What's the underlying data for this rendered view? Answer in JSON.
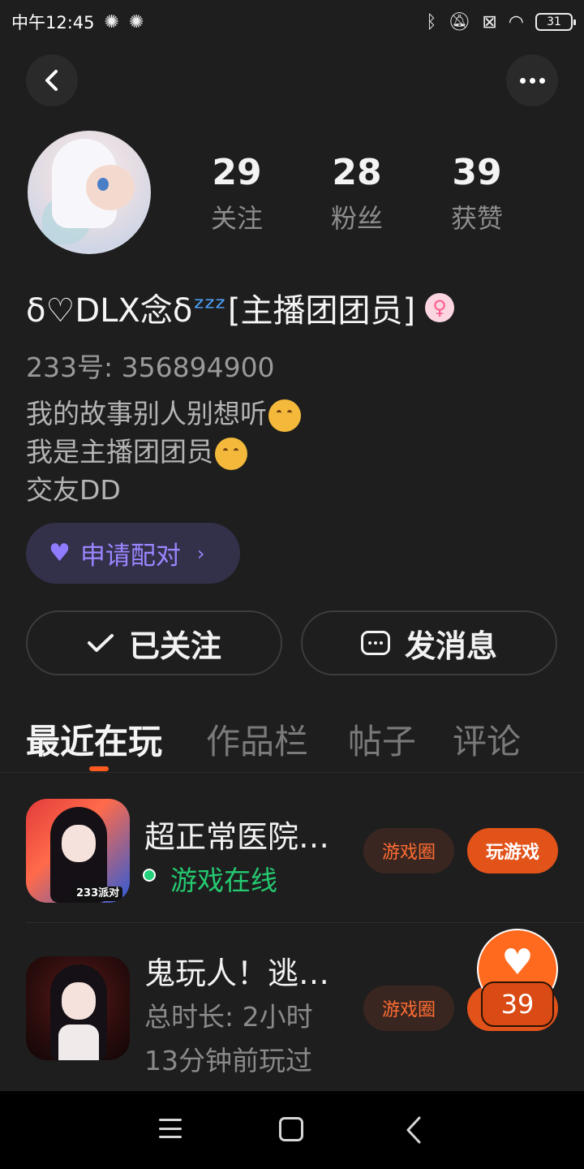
{
  "status_bar": {
    "time": "中午12:45",
    "battery": "31"
  },
  "profile": {
    "nickname_part1": "δ♡DLX念δ",
    "nickname_part2": "[主播团团员]",
    "gender_symbol": "♀",
    "id_text": "233号: 356894900",
    "bio_line1": "我的故事别人别想听",
    "bio_line2": "我是主播团团员",
    "bio_line3": "交友DD"
  },
  "stats": [
    {
      "value": "29",
      "label": "关注"
    },
    {
      "value": "28",
      "label": "粉丝"
    },
    {
      "value": "39",
      "label": "获赞"
    }
  ],
  "pair_button": {
    "label": "申请配对"
  },
  "follow_button": {
    "label": "已关注"
  },
  "message_button": {
    "label": "发消息"
  },
  "tabs": [
    {
      "label": "最近在玩",
      "active": true
    },
    {
      "label": "作品栏",
      "active": false
    },
    {
      "label": "帖子",
      "active": false
    },
    {
      "label": "评论",
      "active": false
    }
  ],
  "games": [
    {
      "title": "超正常医院…",
      "status": "游戏在线",
      "icon_tag": "233派对",
      "circle_label": "游戏圈",
      "play_label": "玩游戏"
    },
    {
      "title": "鬼玩人！逃…",
      "duration": "总时长: 2小时",
      "last_played": "13分钟前玩过",
      "circle_label": "游戏圈"
    }
  ],
  "like_fab": {
    "count": "39"
  },
  "colors": {
    "background": "#1e1e1e",
    "accent_orange": "#ff6a1f",
    "online_green": "#24c970",
    "pair_purple": "#9a86ff"
  }
}
